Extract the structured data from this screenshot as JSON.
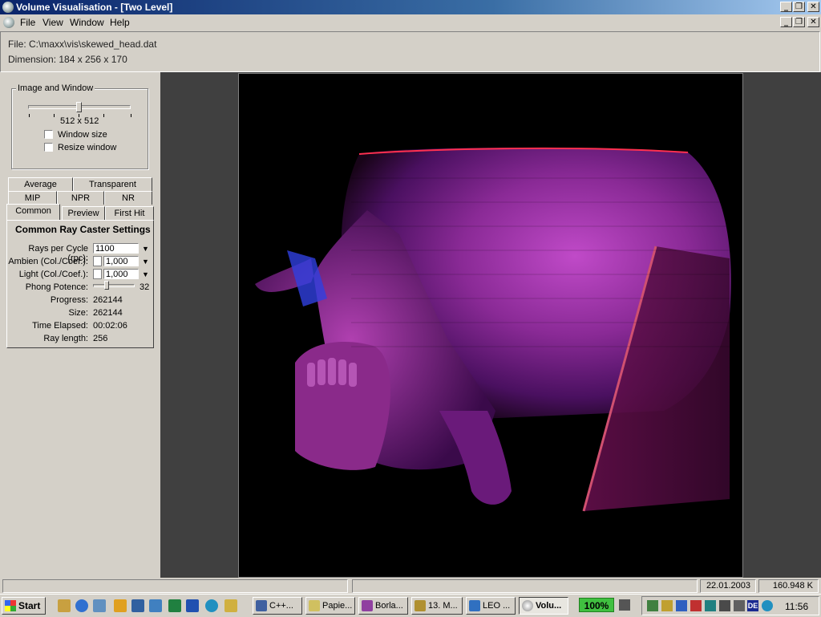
{
  "window": {
    "title": "Volume Visualisation - [Two Level]",
    "buttons": [
      "_",
      "❐",
      "✕"
    ]
  },
  "menu": [
    "File",
    "View",
    "Window",
    "Help"
  ],
  "file_info": {
    "file": "File:  C:\\maxx\\vis\\skewed_head.dat",
    "dimension": "Dimension: 184 x 256 x 170"
  },
  "image_window": {
    "group_label": "Image and Window",
    "size_label": "512 x 512",
    "slider_level": 0.5,
    "window_size_label": "Window size",
    "resize_window_label": "Resize window"
  },
  "tabs": {
    "row1": [
      "Average",
      "Transparent"
    ],
    "row2": [
      "MIP",
      "NPR",
      "NR"
    ],
    "row3": [
      "Common",
      "Preview",
      "First Hit"
    ],
    "active": "Common"
  },
  "settings": {
    "heading": "Common Ray Caster Settings",
    "rays_label": "Rays per Cycle (rpc):",
    "rays_value": "1100",
    "ambien_label": "Ambien (Col./Coef.):",
    "ambien_value": "1,000",
    "light_label": "Light (Col./Coef.):",
    "light_value": "1,000",
    "phong_label": "Phong Potence:",
    "phong_value": "32",
    "phong_level": 0.32,
    "progress_label": "Progress:",
    "progress_value": "262144",
    "size_label": "Size:",
    "size_value": "262144",
    "time_label": "Time Elapsed:",
    "time_value": "00:02:06",
    "ray_length_label": "Ray length:",
    "ray_length_value": "256"
  },
  "status": {
    "date": "22.01.2003",
    "memory": "160.948 K"
  },
  "taskbar": {
    "start_label": "Start",
    "tasks": [
      "C++...",
      "Papie...",
      "Borla...",
      "13. M...",
      "LEO ...",
      "Volu..."
    ],
    "active_task": "Volu...",
    "battery": "100%",
    "lang": "DE",
    "clock": "11:56"
  }
}
